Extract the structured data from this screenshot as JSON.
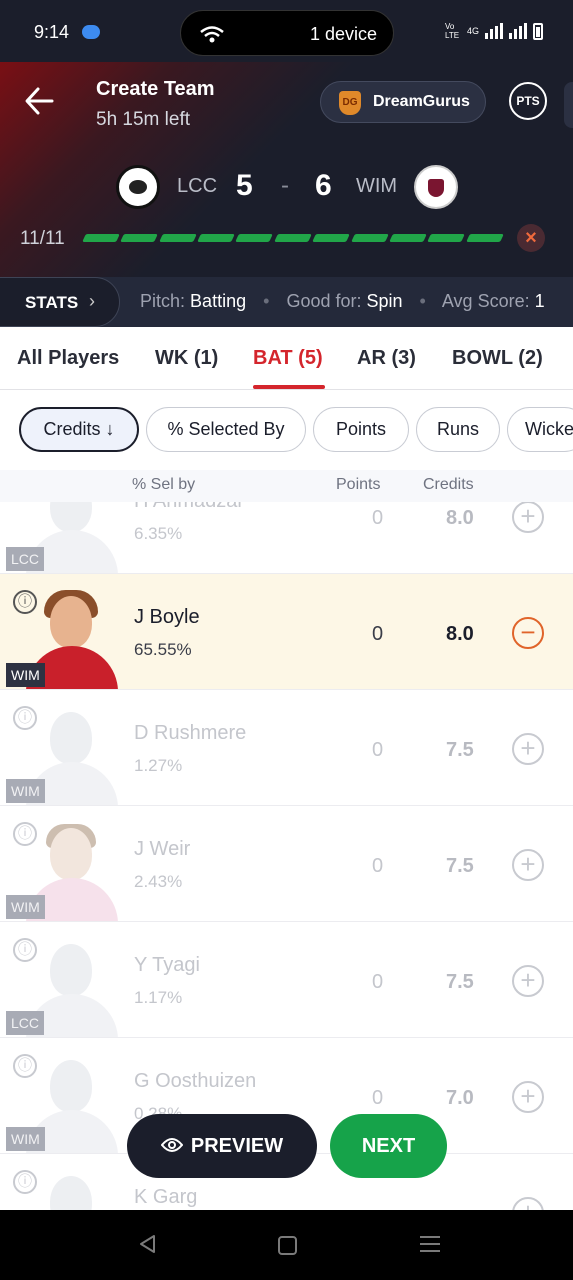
{
  "status_bar": {
    "time": "9:14",
    "cast_label": "1 device",
    "network": "4G",
    "volte": "Vo LTE"
  },
  "header": {
    "title": "Create Team",
    "time_left": "5h 15m left",
    "dreamgurus_label": "DreamGurus",
    "dreamgurus_logo_text": "DG",
    "pts_label": "PTS"
  },
  "match": {
    "team1": "LCC",
    "team2": "WIM",
    "team1_count": "5",
    "separator": "-",
    "team2_count": "6",
    "selected_count": "11/11",
    "progress_fraction": 1.0,
    "accent_color": "#21a649"
  },
  "stats_bar": {
    "button_label": "STATS",
    "pitch_label": "Pitch:",
    "pitch_value": "Batting",
    "good_for_label": "Good for:",
    "good_for_value": "Spin",
    "avg_score_label": "Avg Score:",
    "avg_score_value": "1"
  },
  "tabs": [
    {
      "label": "All Players"
    },
    {
      "label": "WK (1)"
    },
    {
      "label": "BAT (5)",
      "active": true
    },
    {
      "label": "AR (3)"
    },
    {
      "label": "BOWL (2)"
    }
  ],
  "sort_chips": [
    {
      "label": "Credits ↓",
      "active": true
    },
    {
      "label": "% Selected By"
    },
    {
      "label": "Points"
    },
    {
      "label": "Runs"
    },
    {
      "label": "Wicke"
    }
  ],
  "list_header": {
    "sel_by": "% Sel by",
    "points": "Points",
    "credits": "Credits"
  },
  "players": [
    {
      "name": "H Ahmadzai",
      "sel": "6.35%",
      "points": "0",
      "credits": "8.0",
      "team": "LCC",
      "selected": false
    },
    {
      "name": "J Boyle",
      "sel": "65.55%",
      "points": "0",
      "credits": "8.0",
      "team": "WIM",
      "selected": true
    },
    {
      "name": "D Rushmere",
      "sel": "1.27%",
      "points": "0",
      "credits": "7.5",
      "team": "WIM",
      "selected": false
    },
    {
      "name": "J Weir",
      "sel": "2.43%",
      "points": "0",
      "credits": "7.5",
      "team": "WIM",
      "selected": false
    },
    {
      "name": "Y Tyagi",
      "sel": "1.17%",
      "points": "0",
      "credits": "7.5",
      "team": "LCC",
      "selected": false
    },
    {
      "name": "G Oosthuizen",
      "sel": "0.28%",
      "points": "0",
      "credits": "7.0",
      "team": "WIM",
      "selected": false
    },
    {
      "name": "K Garg",
      "sel": "",
      "points": "",
      "credits": "",
      "team": "",
      "selected": false
    }
  ],
  "actions": {
    "preview_label": "PREVIEW",
    "next_label": "NEXT",
    "next_color": "#16a34a"
  },
  "icons": {
    "info": "ⓘ",
    "add": "+",
    "remove": "−",
    "close": "×",
    "chevron": "›"
  }
}
